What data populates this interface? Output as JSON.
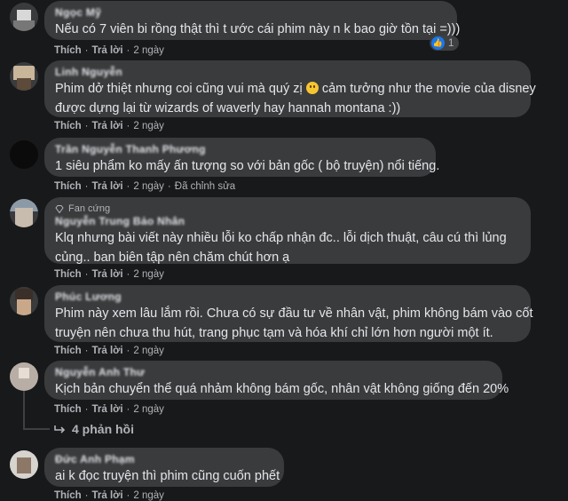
{
  "comments": [
    {
      "name": "Ngọc Mỹ",
      "badge": "",
      "lines": [
        "Nếu có 7 viên bi rồng thật thì t ước cái phim này n k bao giờ tồn tại =)))"
      ],
      "like": "Thích",
      "reply": "Trả lời",
      "time": "2 ngày",
      "edited": "",
      "reaction_count": "1"
    },
    {
      "name": "Linh Nguyễn",
      "badge": "",
      "lines": [
        "Phim dở thiệt nhưng coi cũng vui mà quý zị",
        "được dựng lại từ wizards of waverly hay hannah montana :))"
      ],
      "line1_tail": "cảm tưởng như the movie của disney",
      "like": "Thích",
      "reply": "Trả lời",
      "time": "2 ngày",
      "edited": ""
    },
    {
      "name": "Trần Nguyễn Thanh Phương",
      "badge": "",
      "lines": [
        "1 siêu phẩm ko mấy ấn tượng so với bản gốc ( bộ truyện) nổi tiếng."
      ],
      "like": "Thích",
      "reply": "Trả lời",
      "time": "2 ngày",
      "edited": "Đã chỉnh sửa"
    },
    {
      "name": "Nguyễn Trung Bảo Nhân",
      "badge": "Fan cứng",
      "lines": [
        "Klq nhưng bài viết này nhiều lỗi ko chấp nhận đc.. lỗi dịch thuật, câu cú thì lủng",
        "củng.. ban biên tập nên chăm chút hơn ạ"
      ],
      "like": "Thích",
      "reply": "Trả lời",
      "time": "2 ngày",
      "edited": ""
    },
    {
      "name": "Phúc Lương",
      "badge": "",
      "lines": [
        "Phim này xem lâu lắm rồi. Chưa có sự đầu tư về nhân vật, phim không bám vào cốt",
        "truyện nên chưa thu hút, trang phục tạm và hóa khí chỉ lớn hơn người một ít."
      ],
      "like": "Thích",
      "reply": "Trả lời",
      "time": "2 ngày",
      "edited": ""
    },
    {
      "name": "Nguyễn Anh Thư",
      "badge": "",
      "lines": [
        "Kịch bản chuyển thể quá nhảm không bám gốc, nhân vật không giống đến 20%"
      ],
      "like": "Thích",
      "reply": "Trả lời",
      "time": "2 ngày",
      "edited": ""
    },
    {
      "name": "Đức Anh Phạm",
      "badge": "",
      "lines": [
        "ai k đọc truyện thì phim cũng cuốn phết"
      ],
      "like": "Thích",
      "reply": "Trả lời",
      "time": "2 ngày",
      "edited": ""
    }
  ],
  "replies_link": "4 phản hồi",
  "icons": {
    "like": "like-icon",
    "emoji": "grinning-emoji-icon",
    "badge": "diamond-badge-icon",
    "reply_arrow": "reply-arrow-icon"
  }
}
